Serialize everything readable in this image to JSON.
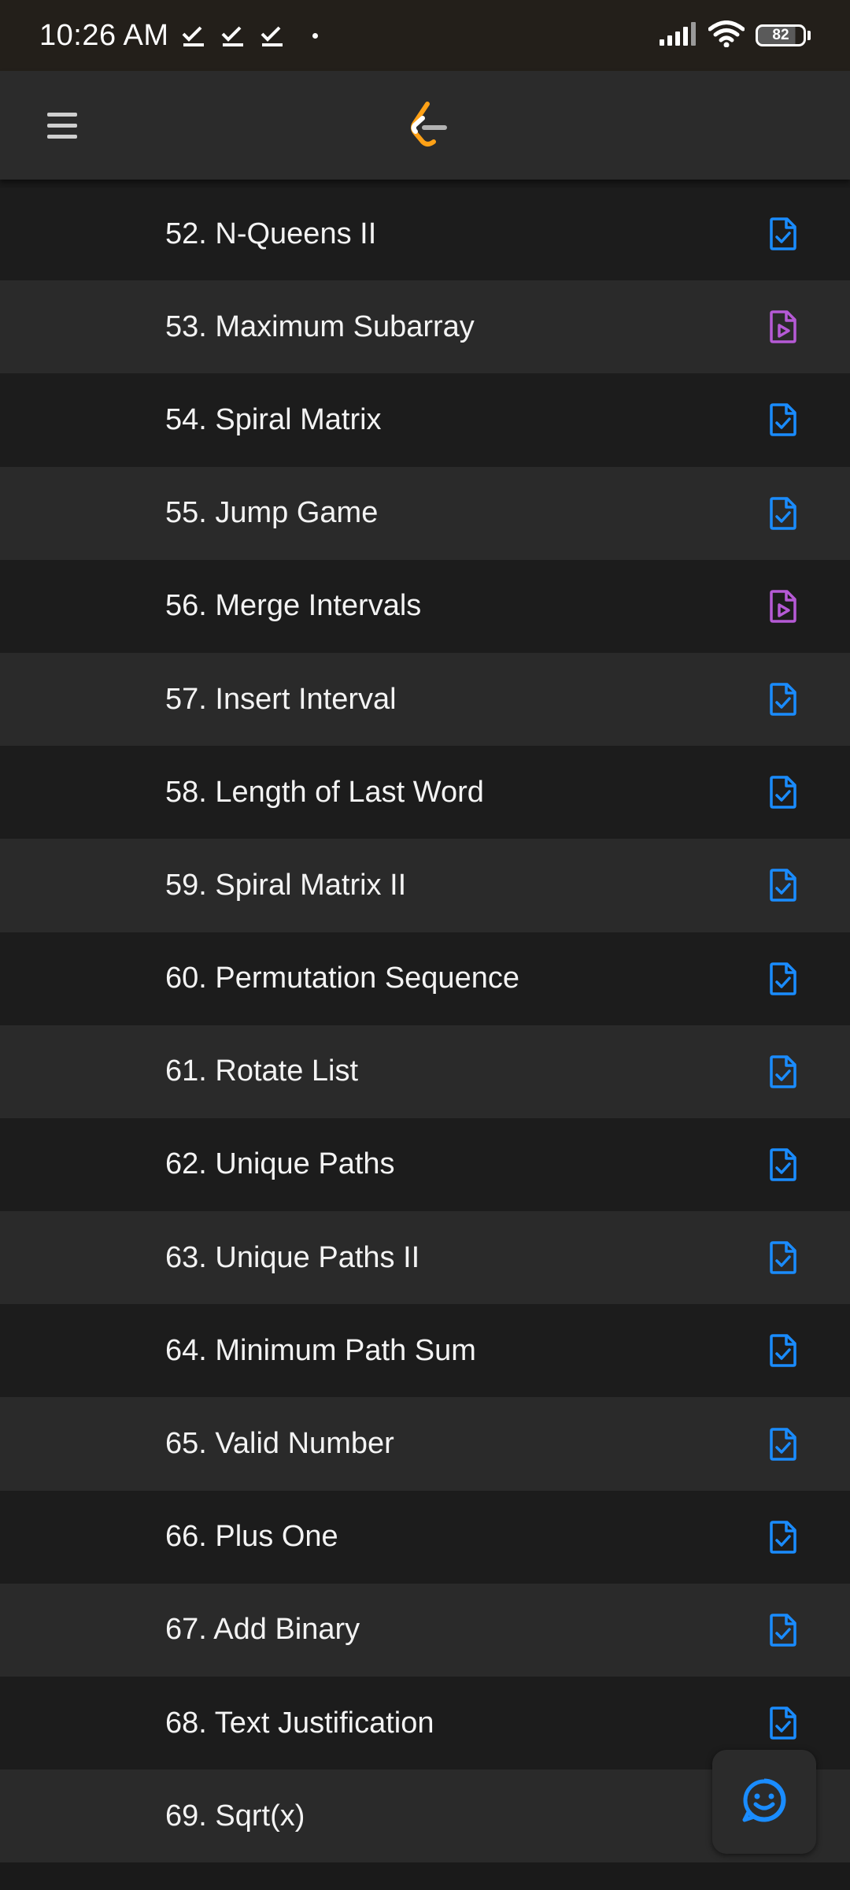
{
  "status_bar": {
    "time": "10:26 AM",
    "battery_level": "82",
    "notification_icons": [
      "check-icon",
      "check-icon",
      "check-icon"
    ],
    "signal_icon": "cell-signal-icon",
    "wifi_icon": "wifi-icon"
  },
  "header": {
    "menu_icon": "hamburger-menu-icon",
    "logo_icon": "leetcode-logo-icon"
  },
  "colors": {
    "solution_icon": "#1a8cff",
    "video_icon": "#b65ad6",
    "row_dark": "#1c1c1c",
    "row_light": "#2a2a2a",
    "header_bg": "#2b2b2b"
  },
  "problems": [
    {
      "title": "52. N-Queens II",
      "icon": "solution"
    },
    {
      "title": "53. Maximum Subarray",
      "icon": "video"
    },
    {
      "title": "54. Spiral Matrix",
      "icon": "solution"
    },
    {
      "title": "55. Jump Game",
      "icon": "solution"
    },
    {
      "title": "56. Merge Intervals",
      "icon": "video"
    },
    {
      "title": "57. Insert Interval",
      "icon": "solution"
    },
    {
      "title": "58. Length of Last Word",
      "icon": "solution"
    },
    {
      "title": "59. Spiral Matrix II",
      "icon": "solution"
    },
    {
      "title": "60. Permutation Sequence",
      "icon": "solution"
    },
    {
      "title": "61. Rotate List",
      "icon": "solution"
    },
    {
      "title": "62. Unique Paths",
      "icon": "solution"
    },
    {
      "title": "63. Unique Paths II",
      "icon": "solution"
    },
    {
      "title": "64. Minimum Path Sum",
      "icon": "solution"
    },
    {
      "title": "65. Valid Number",
      "icon": "solution"
    },
    {
      "title": "66. Plus One",
      "icon": "solution"
    },
    {
      "title": "67. Add Binary",
      "icon": "solution"
    },
    {
      "title": "68. Text Justification",
      "icon": "solution"
    },
    {
      "title": "69. Sqrt(x)",
      "icon": "none"
    }
  ],
  "fab": {
    "icon": "smiley-feedback-icon"
  }
}
